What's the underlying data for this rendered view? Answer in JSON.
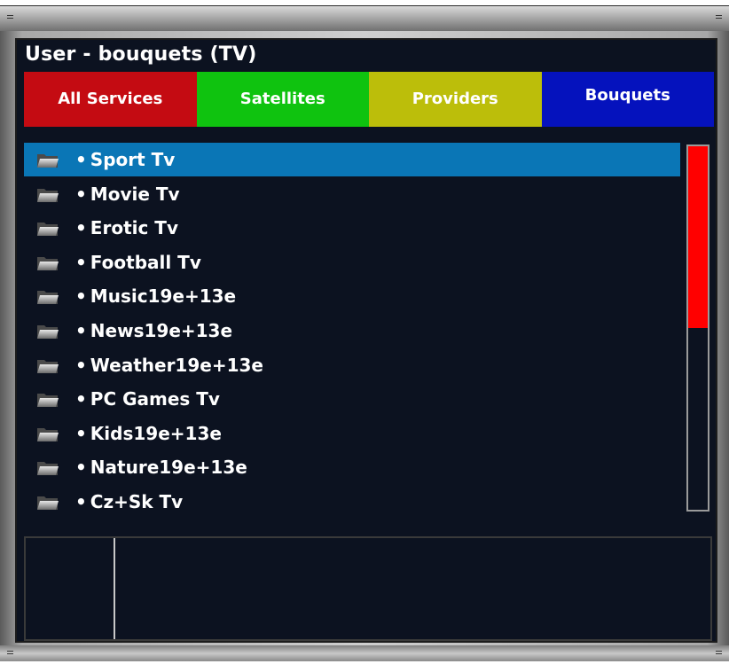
{
  "window": {
    "title": "User - bouquets (TV)"
  },
  "tabs": [
    {
      "label": "All Services",
      "color": "#c40b12",
      "key": "red"
    },
    {
      "label": "Satellites",
      "color": "#0fc30f",
      "key": "green"
    },
    {
      "label": "Providers",
      "color": "#bcbe0a",
      "key": "yellow"
    },
    {
      "label": "Bouquets",
      "color": "#0512bd",
      "key": "blue"
    }
  ],
  "list": {
    "icon": "folder-icon",
    "bullet": "•",
    "selected_index": 0,
    "selection_color": "#0a76b6",
    "items": [
      {
        "label": "Sport Tv"
      },
      {
        "label": "Movie Tv"
      },
      {
        "label": "Erotic Tv"
      },
      {
        "label": "Football Tv"
      },
      {
        "label": "Music19e+13e"
      },
      {
        "label": "News19e+13e"
      },
      {
        "label": "Weather19e+13e"
      },
      {
        "label": "PC Games Tv"
      },
      {
        "label": "Kids19e+13e"
      },
      {
        "label": "Nature19e+13e"
      },
      {
        "label": "Cz+Sk Tv"
      }
    ]
  },
  "scrollbar": {
    "position_fraction": 0.5,
    "thumb_color": "#ff0000"
  }
}
